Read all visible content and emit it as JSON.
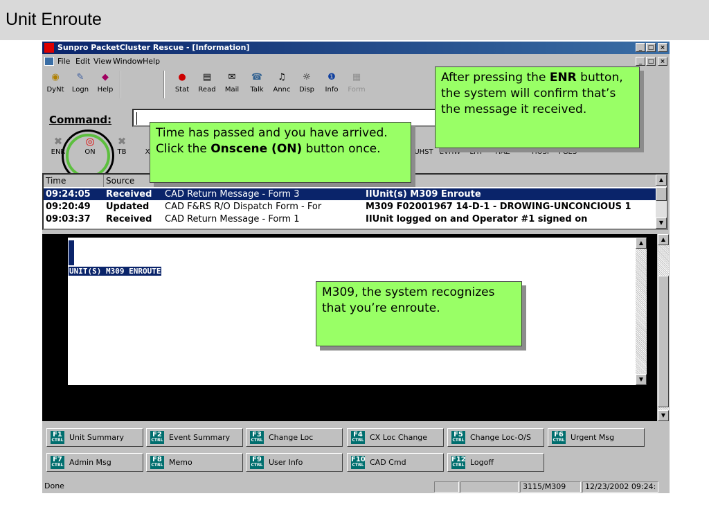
{
  "slide": {
    "title": "Unit Enroute"
  },
  "window": {
    "title": "Sunpro PacketCluster Rescue - [Information]",
    "buttons": [
      "_",
      "□",
      "×"
    ]
  },
  "menu": [
    "File",
    "Edit",
    "View",
    "Window",
    "Help"
  ],
  "toolbar": [
    {
      "label": "DyNt",
      "icon": "dynt-icon"
    },
    {
      "label": "Logn",
      "icon": "logon-icon"
    },
    {
      "label": "Help",
      "icon": "help-icon"
    },
    {
      "label": "Stat",
      "icon": "stat-icon"
    },
    {
      "label": "Read",
      "icon": "read-icon"
    },
    {
      "label": "Mail",
      "icon": "mail-icon"
    },
    {
      "label": "Talk",
      "icon": "talk-icon"
    },
    {
      "label": "Annc",
      "icon": "announce-icon"
    },
    {
      "label": "Disp",
      "icon": "dispatch-icon"
    },
    {
      "label": "Info",
      "icon": "info-icon"
    },
    {
      "label": "Form",
      "icon": "form-icon"
    }
  ],
  "command": {
    "label": "Command:",
    "value": ""
  },
  "unit_toolbar": [
    {
      "label": "ENR",
      "icon": "enroute-icon"
    },
    {
      "label": "ON",
      "icon": "onscene-icon"
    },
    {
      "label": "TB",
      "icon": "tb-icon"
    },
    {
      "label": "X"
    }
  ],
  "unit_toolbar_right": [
    "UHST",
    "EVHW",
    "LHY",
    "HAZ",
    "HOSP",
    "PGES"
  ],
  "list": {
    "headers": [
      "Time",
      "Source"
    ],
    "rows": [
      {
        "time": "09:24:05",
        "status": "Received",
        "source": "CAD Return Message - Form 3",
        "message": "IIUnit(s) M309  Enroute",
        "selected": true
      },
      {
        "time": "09:20:49",
        "status": "Updated",
        "source": "CAD F&RS R/O Dispatch Form - For",
        "message": "M309  F02001967 14-D-1 - DROWING-UNCONCIOUS 1",
        "selected": false
      },
      {
        "time": "09:03:37",
        "status": "Received",
        "source": "CAD Return Message - Form 1",
        "message": "IIUnit logged on and Operator #1 signed on",
        "selected": false
      }
    ]
  },
  "message_pane": {
    "text": "UNIT(S) M309  ENROUTE"
  },
  "fkeys": [
    {
      "key": "F1",
      "label": "Unit Summary"
    },
    {
      "key": "F2",
      "label": "Event Summary"
    },
    {
      "key": "F3",
      "label": "Change Loc"
    },
    {
      "key": "F4",
      "label": "CX Loc Change"
    },
    {
      "key": "F5",
      "label": "Change Loc-O/S"
    },
    {
      "key": "F6",
      "label": "Urgent Msg"
    },
    {
      "key": "F7",
      "label": "Admin Msg"
    },
    {
      "key": "F8",
      "label": "Memo"
    },
    {
      "key": "F9",
      "label": "User Info"
    },
    {
      "key": "F10",
      "label": "CAD Cmd"
    },
    {
      "key": "F12",
      "label": "Logoff"
    }
  ],
  "fkey_ctrl": "CTRL",
  "status": {
    "left": "Done",
    "unit": "3115/M309",
    "datetime": "12/23/2002 09:24:"
  },
  "callouts": {
    "enr_pre": "After pressing the ",
    "enr_bold": "ENR",
    "enr_post": " button, the system will confirm that’s the message it received.",
    "onscene_pre": "Time has passed and you have arrived. Click the ",
    "onscene_bold": "Onscene (ON)",
    "onscene_post": " button once.",
    "m309": "M309, the system recognizes that you’re enroute."
  },
  "colors": {
    "callout": "#99ff66",
    "titlebar": "#0a246a",
    "selection": "#0a246a",
    "circle": "#5cbf3e"
  }
}
